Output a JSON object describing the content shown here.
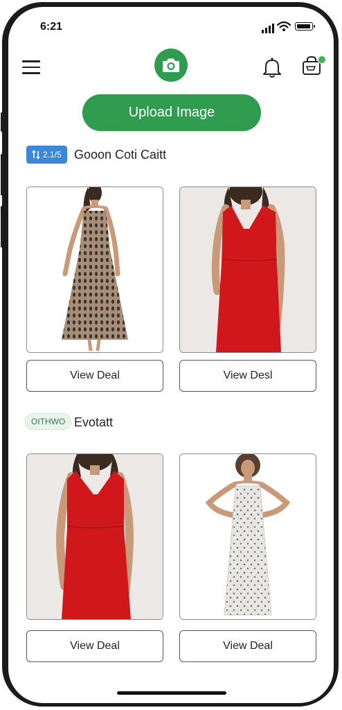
{
  "status_bar": {
    "time": "6:21"
  },
  "header": {
    "menu_icon": "hamburger-icon",
    "camera_icon": "camera-icon",
    "bell_icon": "bell-icon",
    "cart_icon": "cart-icon"
  },
  "upload_button": {
    "label": "Upload Image"
  },
  "sections": [
    {
      "badge": "2.1/5",
      "badge_icon": "swap-icon",
      "title": "Gooon Coti Caitt",
      "products": [
        {
          "name": "patterned-midi-dress",
          "button": "View Deal"
        },
        {
          "name": "red-sleeveless-dress",
          "button": "View Desl"
        }
      ]
    },
    {
      "badge": "OITHWO",
      "title": "Evotatt",
      "products": [
        {
          "name": "red-v-neck-dress",
          "button": "View Deal"
        },
        {
          "name": "white-floral-slip-dress",
          "button": "View Deal"
        }
      ]
    }
  ],
  "colors": {
    "accent_green": "#2f9b4e",
    "badge_blue": "#3d86d9",
    "dress_red": "#d0181c"
  }
}
